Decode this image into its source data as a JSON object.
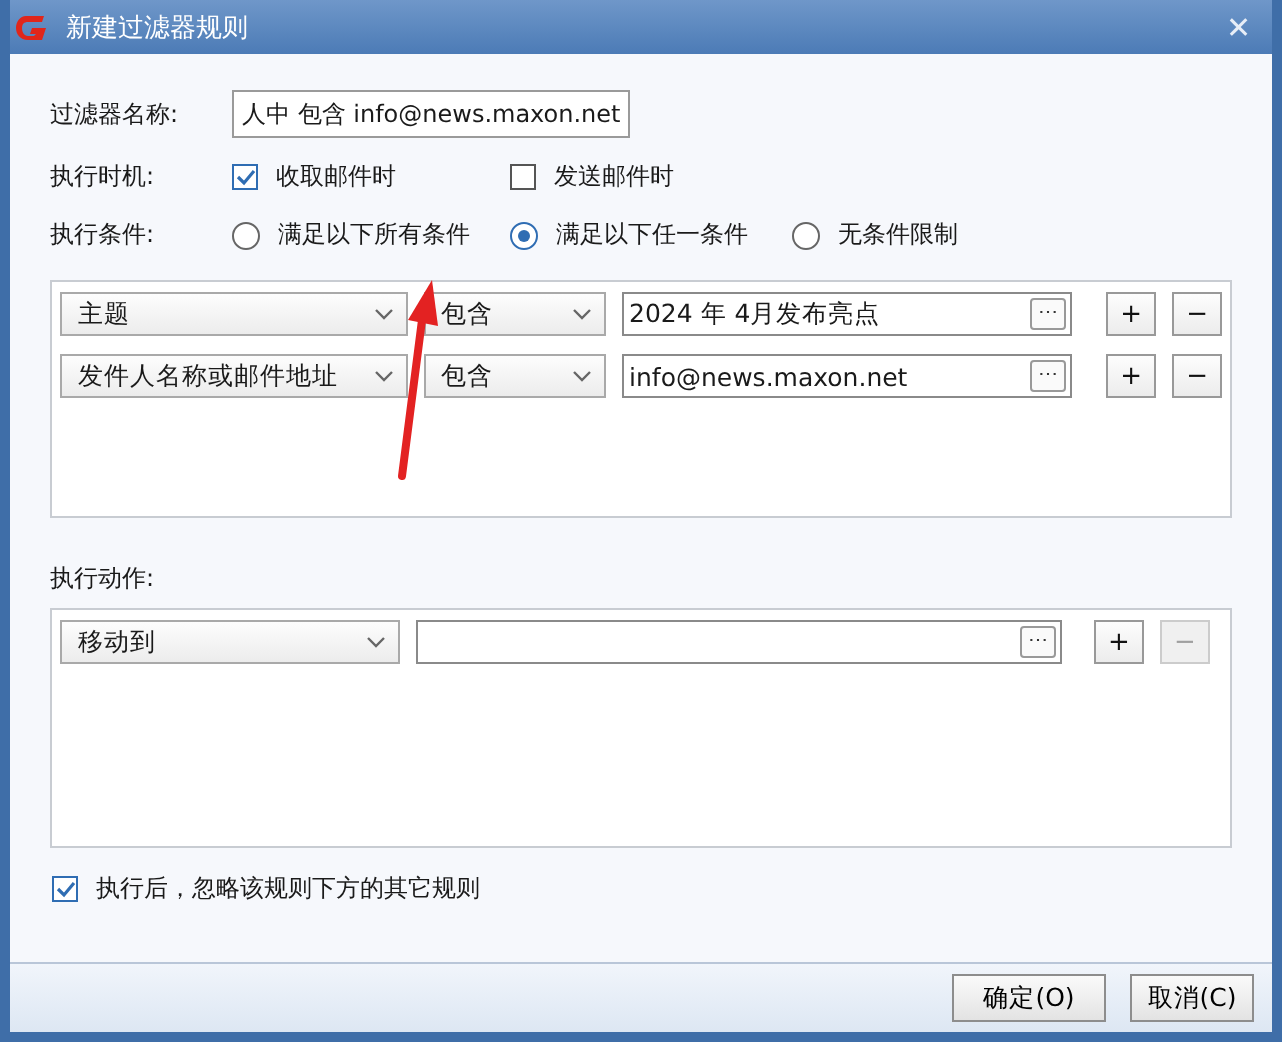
{
  "window": {
    "title": "新建过滤器规则",
    "close": "✕"
  },
  "name_field": {
    "label": "过滤器名称:",
    "value": "人中 包含 info@news.maxon.net"
  },
  "timing": {
    "label": "执行时机:",
    "options": [
      {
        "label": "收取邮件时",
        "checked": true
      },
      {
        "label": "发送邮件时",
        "checked": false
      }
    ]
  },
  "condition_mode": {
    "label": "执行条件:",
    "options": [
      {
        "label": "满足以下所有条件",
        "selected": false
      },
      {
        "label": "满足以下任一条件",
        "selected": true
      },
      {
        "label": "无条件限制",
        "selected": false
      }
    ]
  },
  "conditions": [
    {
      "field": "主题",
      "operator": "包含",
      "value": "2024 年 4月发布亮点",
      "browse": "⋯",
      "add": "+",
      "remove": "−",
      "remove_disabled": false
    },
    {
      "field": "发件人名称或邮件地址",
      "operator": "包含",
      "value": "info@news.maxon.net",
      "browse": "⋯",
      "add": "+",
      "remove": "−",
      "remove_disabled": false
    }
  ],
  "actions_label": "执行动作:",
  "actions": [
    {
      "action": "移动到",
      "browse": "⋯",
      "add": "+",
      "remove": "−",
      "remove_disabled": true
    }
  ],
  "ignore_rest": {
    "label": "执行后，忽略该规则下方的其它规则",
    "checked": true
  },
  "buttons": [
    {
      "label": "确定(O)"
    },
    {
      "label": "取消(C)"
    }
  ]
}
